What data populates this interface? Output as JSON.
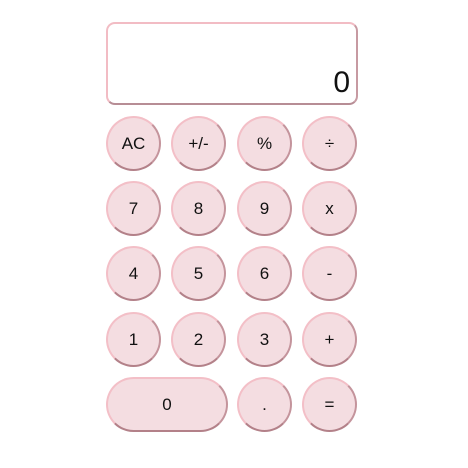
{
  "display": {
    "value": "0"
  },
  "keys": {
    "clear": "AC",
    "sign": "+/-",
    "percent": "%",
    "divide": "÷",
    "seven": "7",
    "eight": "8",
    "nine": "9",
    "multiply": "x",
    "four": "4",
    "five": "5",
    "six": "6",
    "subtract": "-",
    "one": "1",
    "two": "2",
    "three": "3",
    "add": "+",
    "zero": "0",
    "decimal": ".",
    "equals": "="
  },
  "colors": {
    "key_fill": "#f4dde1",
    "key_border_light": "#f3bfc7",
    "key_border_dark": "#b38189",
    "display_border": "#f2bcc4"
  }
}
